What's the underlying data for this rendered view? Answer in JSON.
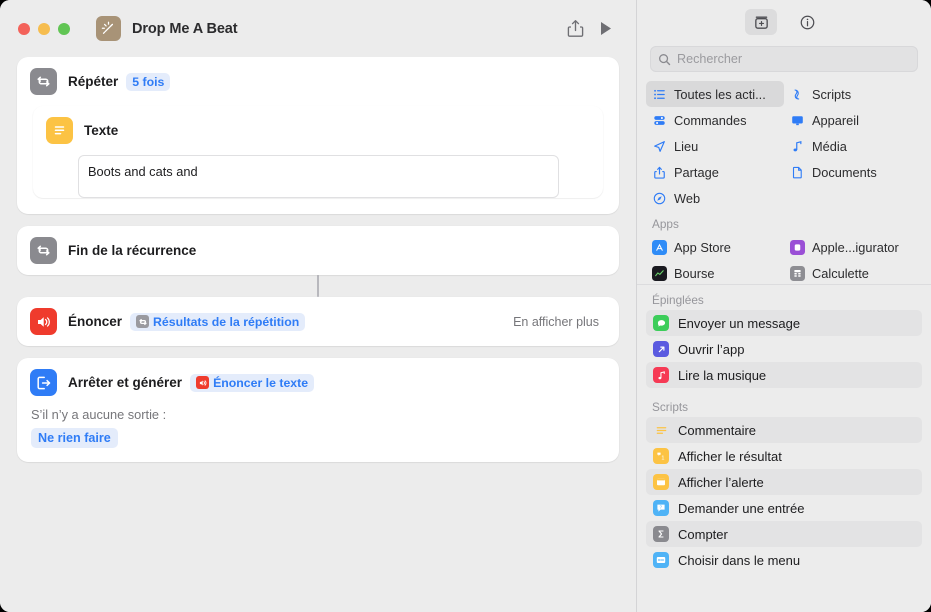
{
  "window": {
    "app_icon": "magic-wand-icon",
    "doc_title": "Drop Me A Beat",
    "traffic_lights": [
      "close",
      "minimize",
      "zoom"
    ],
    "toolbar": {
      "share_label": "share-icon",
      "play_label": "play-icon"
    }
  },
  "workflow": {
    "actions": [
      {
        "id": "repeat",
        "icon": "repeat-icon",
        "icon_color": "#8a8a8f",
        "title": "Répéter",
        "pill": "5 fois"
      },
      {
        "id": "text",
        "icon": "text-lines-icon",
        "icon_color": "#fcc344",
        "title": "Texte",
        "field_value": "Boots and cats and"
      },
      {
        "id": "end-repeat",
        "icon": "repeat-icon",
        "icon_color": "#8a8a8f",
        "title": "Fin de la récurrence"
      },
      {
        "id": "speak",
        "icon": "speaker-icon",
        "icon_color": "#ef3b2d",
        "title": "Énoncer",
        "token": "Résultats de la répétition",
        "token_icon": "repeat-token-icon",
        "show_more": "En afficher plus"
      },
      {
        "id": "stop-and-output",
        "icon": "exit-icon",
        "icon_color": "#2f7cf6",
        "title": "Arrêter et générer",
        "token": "Énoncer le texte",
        "token_icon": "speaker-token-icon",
        "no_output_label": "S’il n’y a aucune sortie :",
        "no_output_value": "Ne rien faire"
      }
    ]
  },
  "sidebar": {
    "toolbar": [
      {
        "name": "action-library-icon",
        "active": true
      },
      {
        "name": "info-icon",
        "active": false
      }
    ],
    "search": {
      "placeholder": "Rechercher",
      "value": "",
      "icon": "search-icon"
    },
    "categories": [
      {
        "label": "Toutes les acti...",
        "icon": "list-icon",
        "selected": true
      },
      {
        "label": "Scripts",
        "icon": "scroll-icon",
        "selected": false
      },
      {
        "label": "Commandes",
        "icon": "controls-icon",
        "selected": false
      },
      {
        "label": "Appareil",
        "icon": "display-icon",
        "selected": false
      },
      {
        "label": "Lieu",
        "icon": "location-arrow-icon",
        "selected": false
      },
      {
        "label": "Média",
        "icon": "music-note-icon",
        "selected": false
      },
      {
        "label": "Partage",
        "icon": "share-up-icon",
        "selected": false
      },
      {
        "label": "Documents",
        "icon": "document-icon",
        "selected": false
      },
      {
        "label": "Web",
        "icon": "compass-icon",
        "selected": false
      }
    ],
    "apps_section": {
      "title": "Apps",
      "items": [
        {
          "label": "App Store",
          "icon": "app-store-icon",
          "color": "#2f8cf7"
        },
        {
          "label": "Apple...igurator",
          "icon": "apple-configurator-icon",
          "color": "#9a4fd6"
        },
        {
          "label": "Bourse",
          "icon": "stocks-icon",
          "color": "#1a1a20"
        },
        {
          "label": "Calculette",
          "icon": "calculator-icon",
          "color": "#8e8e93"
        }
      ]
    },
    "pinned_section": {
      "title": "Épinglées",
      "items": [
        {
          "label": "Envoyer un message",
          "icon": "message-bubble-icon",
          "color": "#3ccd5a"
        },
        {
          "label": "Ouvrir l’app",
          "icon": "open-app-arrow-icon",
          "color": "#5a5ae0"
        },
        {
          "label": "Lire la musique",
          "icon": "music-icon",
          "color": "#f63a55"
        }
      ]
    },
    "scripts_section": {
      "title": "Scripts",
      "items": [
        {
          "label": "Commentaire",
          "icon": "comment-lines-icon",
          "color": "#ffffff",
          "glyph_color": "#fcc344"
        },
        {
          "label": "Afficher le résultat",
          "icon": "show-result-icon",
          "color": "#fcc344"
        },
        {
          "label": "Afficher l’alerte",
          "icon": "alert-window-icon",
          "color": "#fcc344"
        },
        {
          "label": "Demander une entrée",
          "icon": "ask-input-icon",
          "color": "#4fb3f6"
        },
        {
          "label": "Compter",
          "icon": "sigma-count-icon",
          "color": "#8a8a8f"
        },
        {
          "label": "Choisir dans le menu",
          "icon": "choose-menu-icon",
          "color": "#4fb3f6"
        }
      ]
    }
  },
  "colors": {
    "accent_blue": "#2f7cf6",
    "window_bg": "#ececec",
    "card_bg": "#ffffff",
    "pill_bg": "#e4ecfb"
  }
}
